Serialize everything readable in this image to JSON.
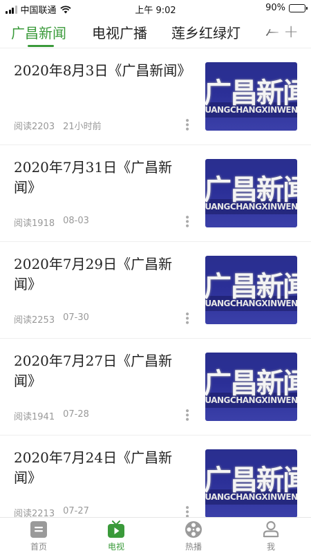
{
  "status_bar": {
    "carrier": "中国联通",
    "time": "上午 9:02",
    "battery": "90%",
    "battery_level": 0.9,
    "icons": [
      "signal-icon",
      "wifi-icon",
      "battery-icon"
    ]
  },
  "tabs": {
    "items": [
      {
        "label": "广昌新闻",
        "active": true
      },
      {
        "label": "电视广播",
        "active": false
      },
      {
        "label": "莲乡红绿灯",
        "active": false
      },
      {
        "label": "𠂉",
        "active": false
      }
    ],
    "add_icon": "plus-icon",
    "active_color": "#3a9a3a"
  },
  "news": [
    {
      "title": "2020年8月3日《广昌新闻》",
      "reads": "阅读2203",
      "time": "21小时前"
    },
    {
      "title": "2020年7月31日《广昌新闻》",
      "reads": "阅读1918",
      "time": "08-03"
    },
    {
      "title": "2020年7月29日《广昌新闻》",
      "reads": "阅读2253",
      "time": "07-30"
    },
    {
      "title": "2020年7月27日《广昌新闻》",
      "reads": "阅读1941",
      "time": "07-28"
    },
    {
      "title": "2020年7月24日《广昌新闻》",
      "reads": "阅读2213",
      "time": "07-27"
    }
  ],
  "thumbnail": {
    "title": "广昌新闻",
    "subtitle": "GUANGCHANGXINWEN"
  },
  "bottom_nav": {
    "items": [
      {
        "label": "首页",
        "icon": "home-icon",
        "active": false
      },
      {
        "label": "电视",
        "icon": "tv-icon",
        "active": true
      },
      {
        "label": "热播",
        "icon": "film-reel-icon",
        "active": false
      },
      {
        "label": "我",
        "icon": "user-icon",
        "active": false
      }
    ]
  }
}
